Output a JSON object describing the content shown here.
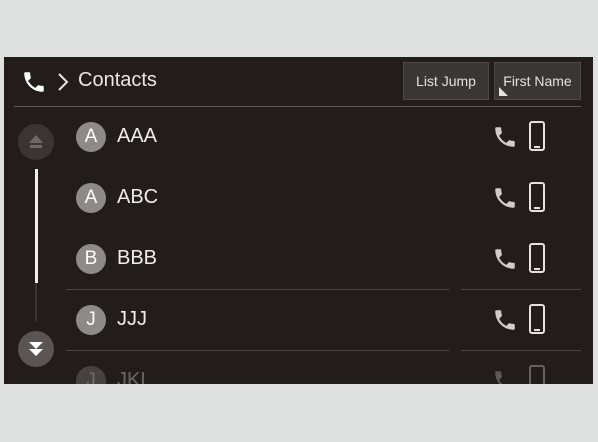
{
  "header": {
    "phone_icon": "phone-icon",
    "breadcrumb_icon": "chevron-right-icon",
    "title": "Contacts",
    "list_jump_label": "List Jump",
    "sort_label": "First Name"
  },
  "scroll": {
    "up_icon": "scroll-up-icon",
    "down_icon": "scroll-down-icon"
  },
  "contacts": [
    {
      "initial": "A",
      "name": "AAA"
    },
    {
      "initial": "A",
      "name": "ABC"
    },
    {
      "initial": "B",
      "name": "BBB"
    },
    {
      "initial": "J",
      "name": "JJJ"
    },
    {
      "initial": "J",
      "name": "JKL"
    }
  ],
  "colors": {
    "screen_bg": "#221c1a",
    "button_bg": "#3a3634",
    "avatar_bg": "#8d8a88",
    "text": "#f0eeec"
  }
}
